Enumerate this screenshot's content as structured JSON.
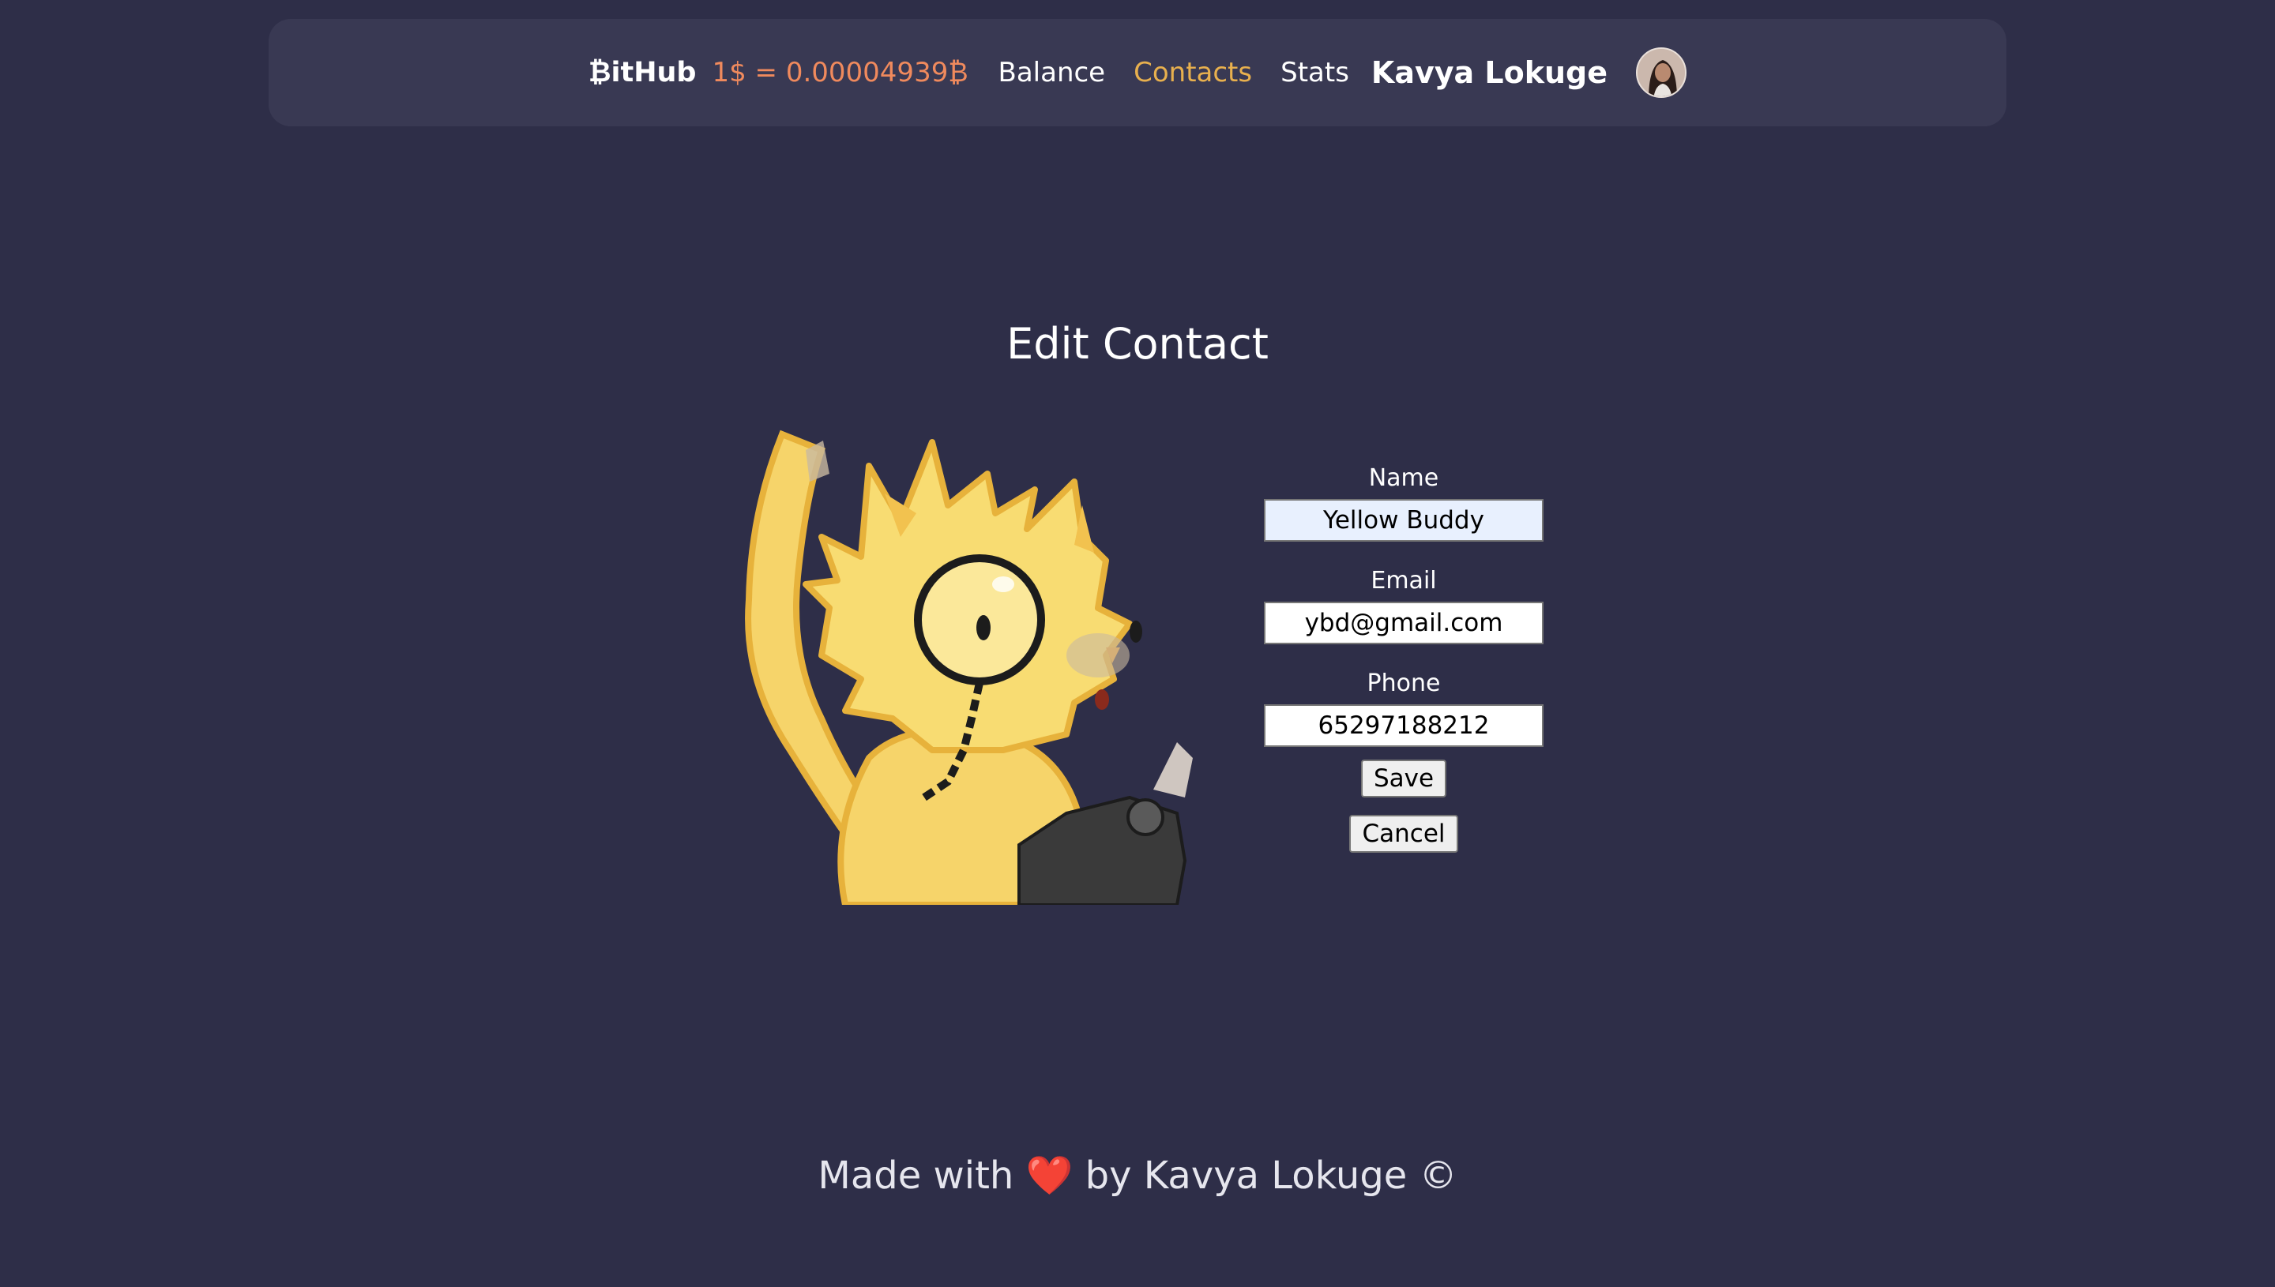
{
  "header": {
    "brand": "₿itHub",
    "rate": "1$ = 0.00004939₿",
    "nav": [
      {
        "label": "Balance",
        "active": false
      },
      {
        "label": "Contacts",
        "active": true
      },
      {
        "label": "Stats",
        "active": false
      }
    ],
    "user_name": "Kavya Lokuge",
    "accent_color": "#e8b04e",
    "rate_color": "#f08a5d"
  },
  "main": {
    "title": "Edit Contact",
    "illustration_icon": "yellow-cat-with-monocle-illustration",
    "form": {
      "name_label": "Name",
      "name_value": "Yellow Buddy",
      "email_label": "Email",
      "email_value": "ybd@gmail.com",
      "phone_label": "Phone",
      "phone_value": "65297188212",
      "save_label": "Save",
      "cancel_label": "Cancel"
    }
  },
  "footer": {
    "text_before": "Made with",
    "heart": "❤️",
    "text_after": "by Kavya Lokuge ©"
  }
}
